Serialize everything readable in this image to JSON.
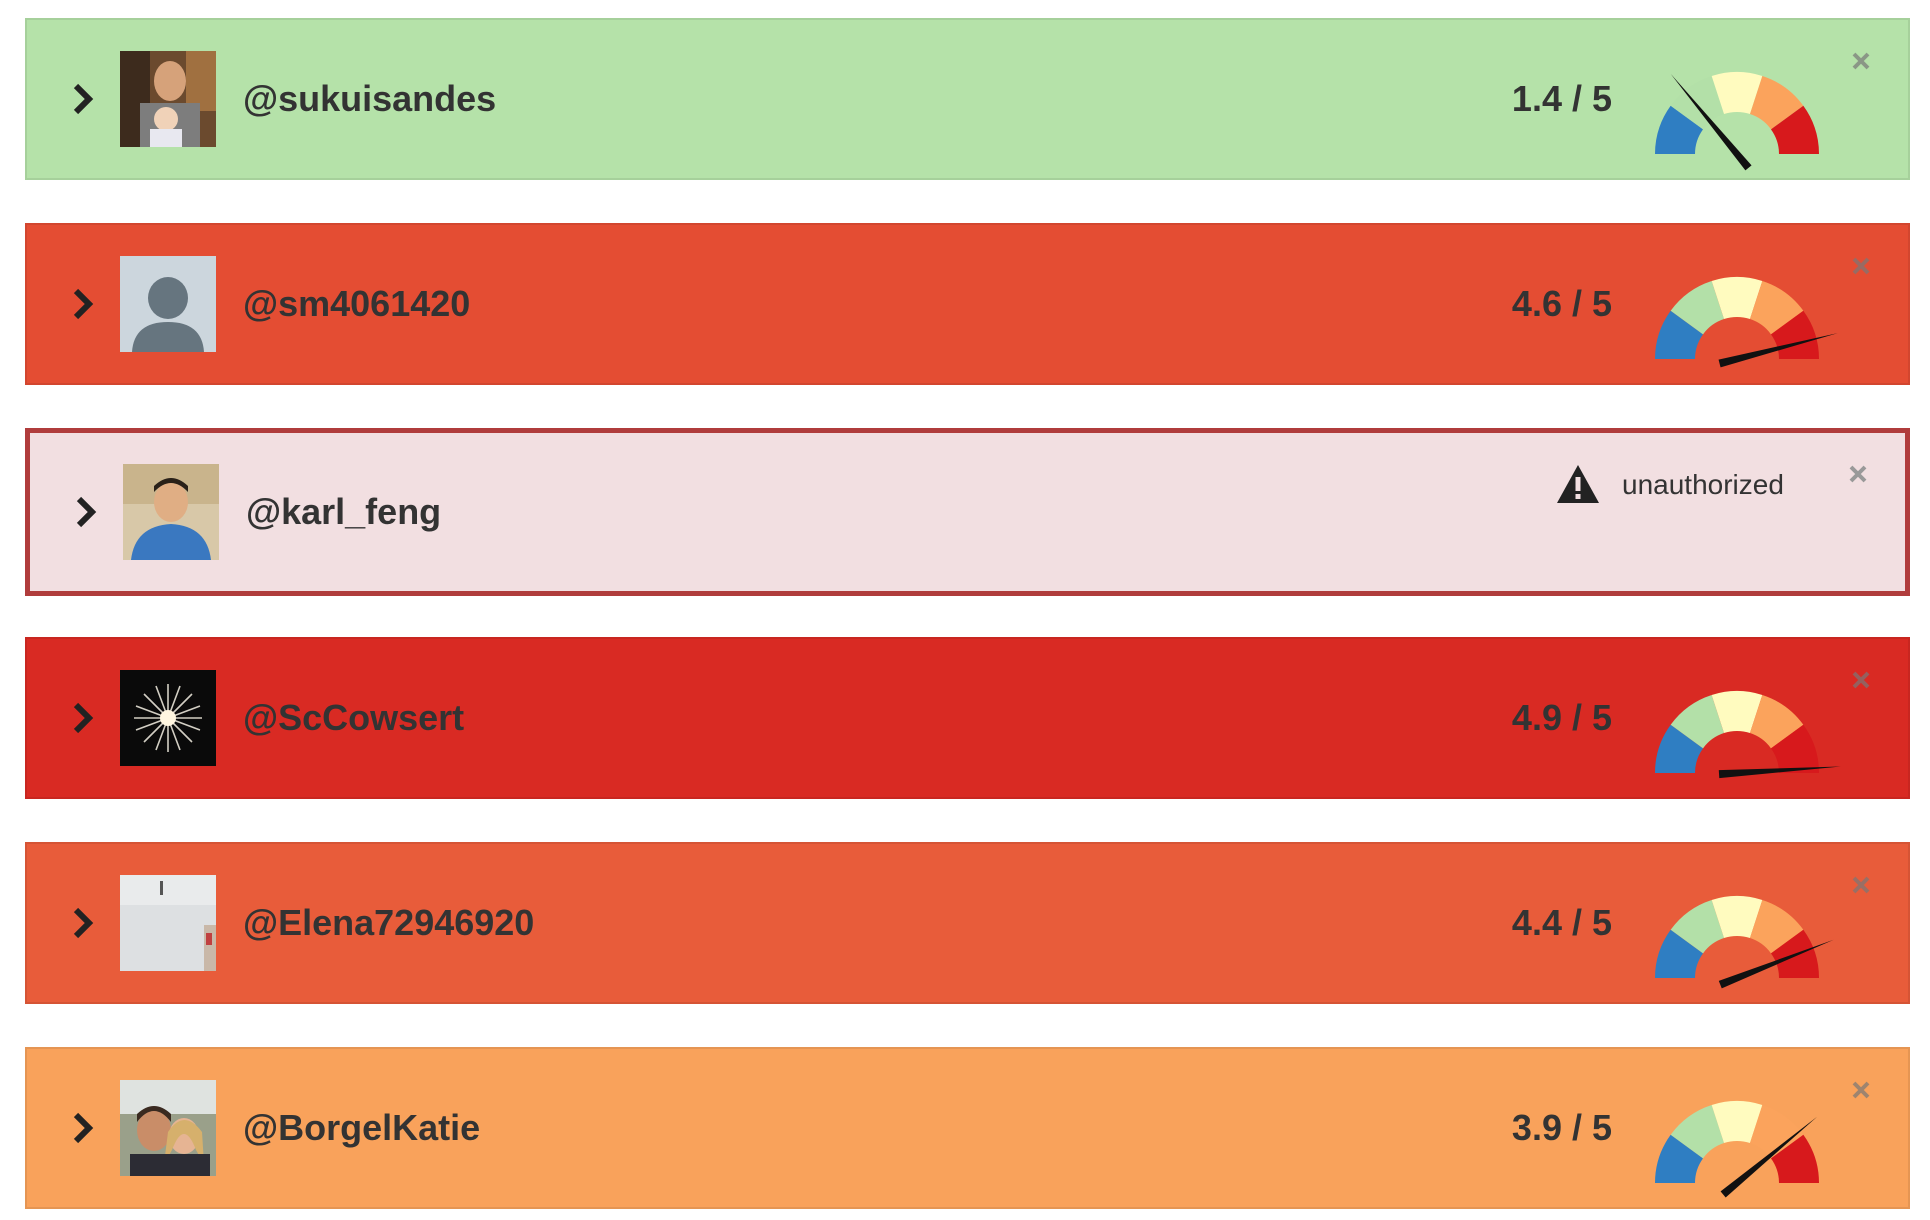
{
  "gauge_colors": [
    "#2f7ec2",
    "#b3e0a8",
    "#fffbbf",
    "#fba35c",
    "#d7191c"
  ],
  "rows": [
    {
      "handle": "@sukuisandes",
      "score_text": "1.4 / 5",
      "score": 1.4,
      "bg": "#b5e2a9",
      "avatar": "photo-man-with-baby"
    },
    {
      "handle": "@sm4061420",
      "score_text": "4.6 / 5",
      "score": 4.6,
      "bg": "#e44d33",
      "avatar": "default-silhouette"
    },
    {
      "handle": "@karl_feng",
      "status": "unauthorized",
      "status_icon": "warning-icon",
      "bg": "#f2dfe1",
      "border": "#b03c3c",
      "avatar": "photo-man-blue-shirt"
    },
    {
      "handle": "@ScCowsert",
      "score_text": "4.9 / 5",
      "score": 4.9,
      "bg": "#d92a23",
      "avatar": "photo-firework"
    },
    {
      "handle": "@Elena72946920",
      "score_text": "4.4 / 5",
      "score": 4.4,
      "bg": "#e85c3a",
      "avatar": "photo-snow"
    },
    {
      "handle": "@BorgelKatie",
      "score_text": "3.9 / 5",
      "score": 3.9,
      "bg": "#f9a25b",
      "avatar": "photo-couple"
    }
  ]
}
